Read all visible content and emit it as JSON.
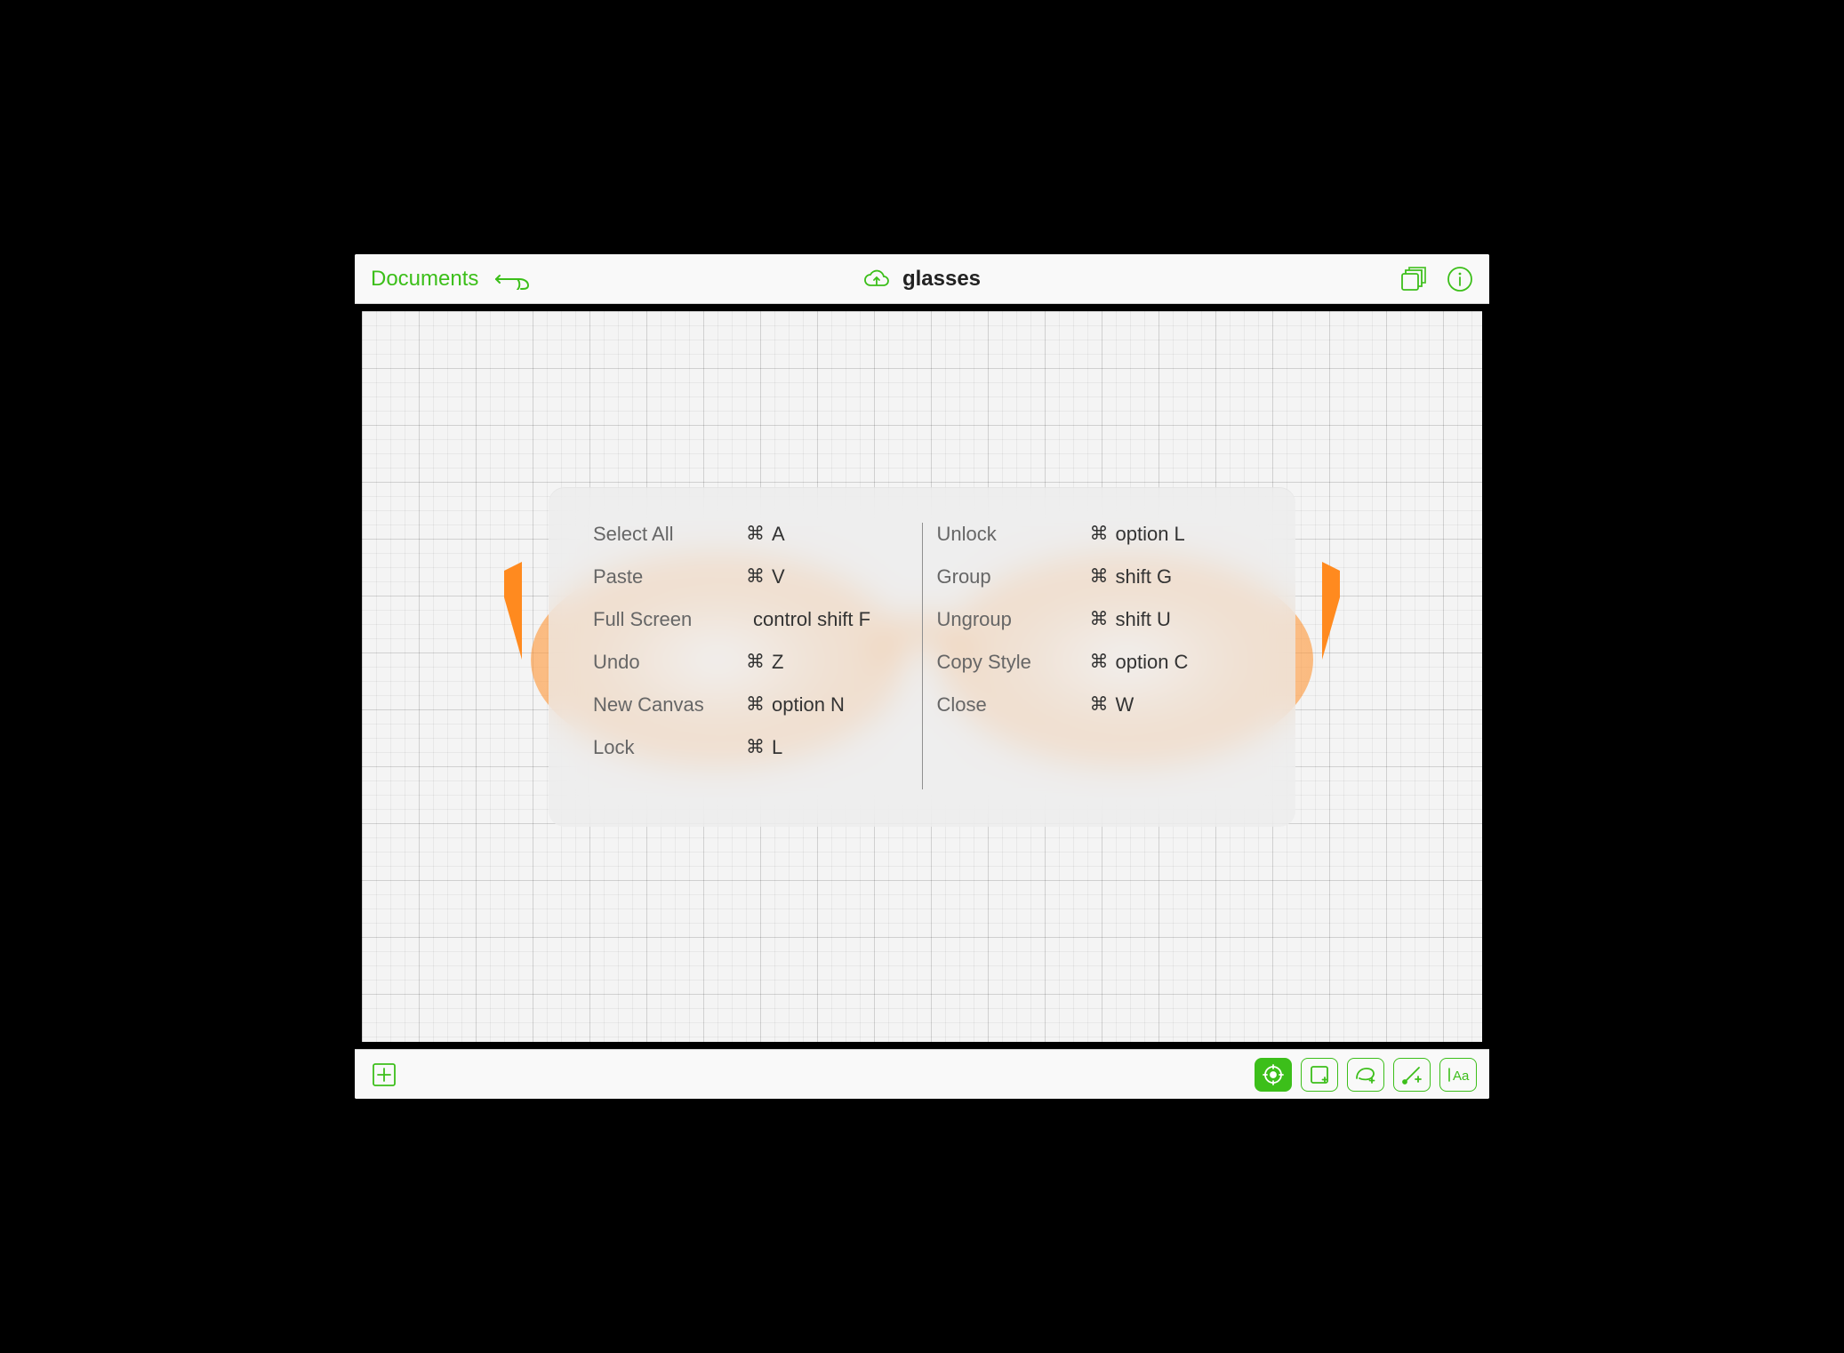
{
  "topbar": {
    "documents_label": "Documents",
    "doc_title": "glasses"
  },
  "shortcuts": {
    "left": [
      {
        "label": "Select All",
        "cmd": "⌘",
        "keys": "A"
      },
      {
        "label": "Paste",
        "cmd": "⌘",
        "keys": "V"
      },
      {
        "label": "Full Screen",
        "cmd": "",
        "keys": "control shift F"
      },
      {
        "label": "Undo",
        "cmd": "⌘",
        "keys": "Z"
      },
      {
        "label": "New Canvas",
        "cmd": "⌘",
        "keys": "option N"
      },
      {
        "label": "Lock",
        "cmd": "⌘",
        "keys": "L"
      }
    ],
    "right": [
      {
        "label": "Unlock",
        "cmd": "⌘",
        "keys": "option L"
      },
      {
        "label": "Group",
        "cmd": "⌘",
        "keys": "shift G"
      },
      {
        "label": "Ungroup",
        "cmd": "⌘",
        "keys": "shift U"
      },
      {
        "label": "Copy Style",
        "cmd": "⌘",
        "keys": "option C"
      },
      {
        "label": "Close",
        "cmd": "⌘",
        "keys": "W"
      }
    ]
  },
  "colors": {
    "accent_green": "#3cbf1a",
    "glasses_orange": "#ff8a1f"
  }
}
